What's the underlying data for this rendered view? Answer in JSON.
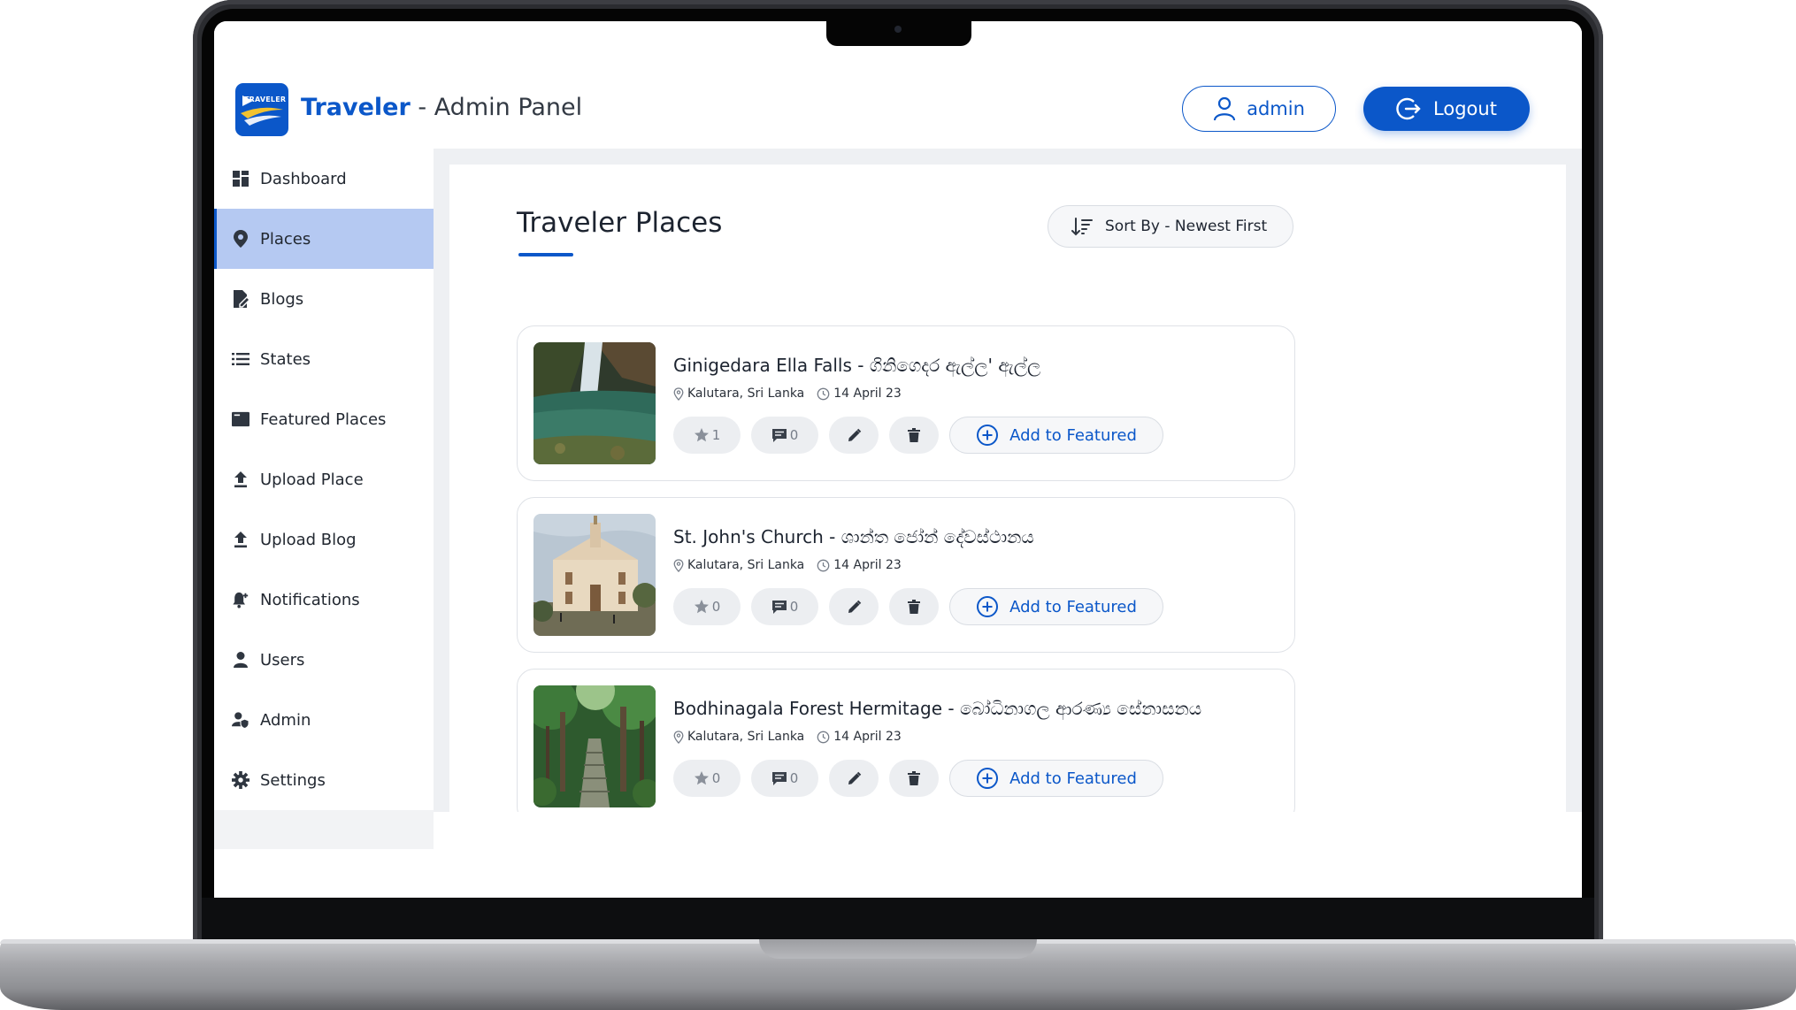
{
  "header": {
    "brand_name": "Traveler",
    "brand_suffix": " - Admin Panel",
    "logo_text": "TRAVELER",
    "user_label": "admin",
    "logout_label": "Logout"
  },
  "sidebar": {
    "items": [
      {
        "label": "Dashboard",
        "icon": "dashboard-icon"
      },
      {
        "label": "Places",
        "icon": "map-pin-icon",
        "active": true
      },
      {
        "label": "Blogs",
        "icon": "blog-edit-icon"
      },
      {
        "label": "States",
        "icon": "list-icon"
      },
      {
        "label": "Featured Places",
        "icon": "featured-icon"
      },
      {
        "label": "Upload Place",
        "icon": "upload-icon"
      },
      {
        "label": "Upload Blog",
        "icon": "upload-icon"
      },
      {
        "label": "Notifications",
        "icon": "bell-icon"
      },
      {
        "label": "Users",
        "icon": "user-icon"
      },
      {
        "label": "Admin",
        "icon": "admin-shield-icon"
      },
      {
        "label": "Settings",
        "icon": "gear-icon"
      }
    ]
  },
  "main": {
    "title": "Traveler Places",
    "sort_label": "Sort By - Newest First",
    "places": [
      {
        "title": "Ginigedara Ella Falls - ගිනිගෙදර ඇල්ල' ඇල්ල",
        "location": "Kalutara, Sri Lanka",
        "date": "14 April 23",
        "rating": "1",
        "comments": "0",
        "featured_label": "Add to Featured"
      },
      {
        "title": "St. John's Church - ශාන්ත ජෝන් දේවස්ථානය",
        "location": "Kalutara, Sri Lanka",
        "date": "14 April 23",
        "rating": "0",
        "comments": "0",
        "featured_label": "Add to Featured"
      },
      {
        "title": "Bodhinagala Forest Hermitage - බෝධිනාගල ආරණ්‍ය සේනාසනය",
        "location": "Kalutara, Sri Lanka",
        "date": "14 April 23",
        "rating": "0",
        "comments": "0",
        "featured_label": "Add to Featured"
      }
    ]
  },
  "colors": {
    "accent": "#0b57c9",
    "sidebar_active": "#b5c9f2",
    "content_bg": "#eef0f3"
  }
}
